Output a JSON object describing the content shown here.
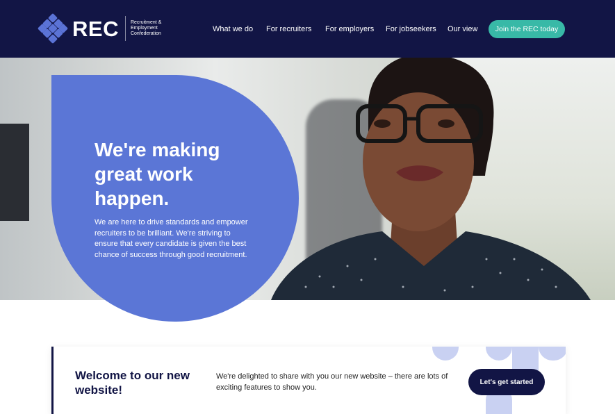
{
  "header": {
    "logo_text": "REC",
    "logo_sub": "Recruitment & Employment Confederation",
    "nav": [
      {
        "label": "What we do"
      },
      {
        "label": "For recruiters"
      },
      {
        "label": "For employers"
      },
      {
        "label": "For jobseekers"
      },
      {
        "label": "Our view"
      }
    ],
    "cta_label": "Join the REC today"
  },
  "hero": {
    "title": "We're making great work happen.",
    "body": "We are here to drive standards and empower recruiters to be brilliant. We're striving to ensure that every candidate is given the best chance of success through good recruitment."
  },
  "welcome": {
    "title": "Welcome to our new website!",
    "text": "We're delighted to share with you our new website – there are lots of exciting features to show you.",
    "button_label": "Let's get started"
  },
  "colors": {
    "navy": "#121545",
    "accent_blue": "#5b76d6",
    "teal": "#38b9a7",
    "light_blue": "#c9d1f2"
  },
  "icons": {
    "logo_mark": "diamond-grid-icon"
  }
}
